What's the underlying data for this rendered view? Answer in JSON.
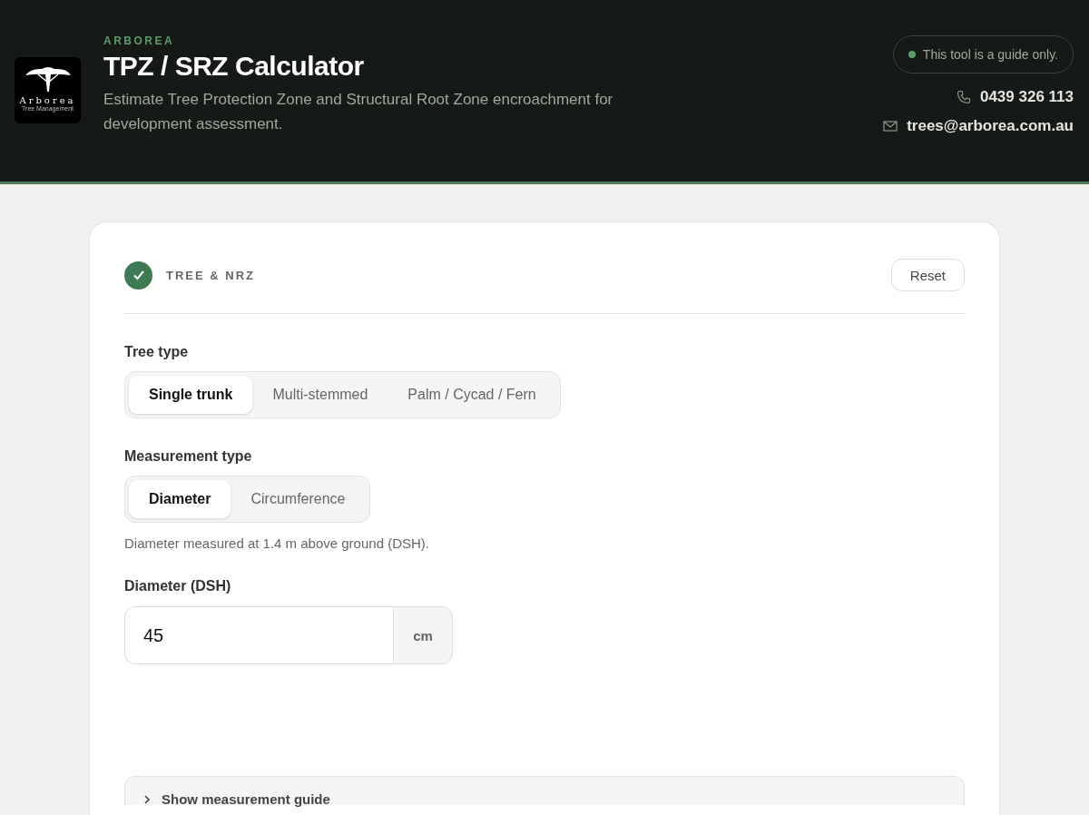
{
  "header": {
    "logo": {
      "name": "Arborea",
      "tagline": "Tree Management"
    },
    "brand": "ARBOREA",
    "title": "TPZ / SRZ Calculator",
    "subtitle": "Estimate Tree Protection Zone and Structural Root Zone encroachment for development assessment.",
    "notice": "This tool is a guide only.",
    "phone": "0439 326 113",
    "email": "trees@arborea.com.au"
  },
  "step": {
    "title": "TREE & NRZ",
    "complete": true,
    "reset": "Reset"
  },
  "tree_type": {
    "label": "Tree type",
    "options": [
      {
        "label": "Single trunk",
        "selected": true
      },
      {
        "label": "Multi-stemmed",
        "selected": false
      },
      {
        "label": "Palm / Cycad / Fern",
        "selected": false
      }
    ]
  },
  "measurement_type": {
    "label": "Measurement type",
    "options": [
      {
        "label": "Diameter",
        "selected": true
      },
      {
        "label": "Circumference",
        "selected": false
      }
    ],
    "hint": "Diameter measured at 1.4 m above ground (DSH)."
  },
  "diameter": {
    "label": "Diameter (DSH)",
    "value": "45",
    "unit": "cm"
  },
  "guide": {
    "label": "Show measurement guide",
    "expanded": false
  }
}
